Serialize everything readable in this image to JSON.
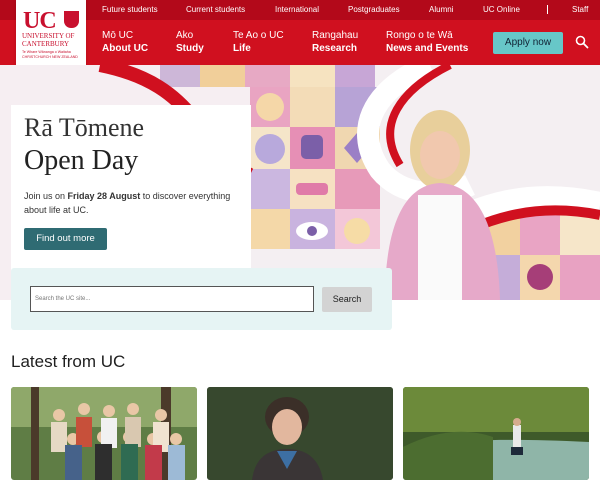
{
  "topbar": {
    "links": [
      "Future students",
      "Current students",
      "International",
      "Postgraduates",
      "Alumni",
      "UC Online",
      "Staff"
    ]
  },
  "logo": {
    "wordmark": "UC",
    "name_line1": "UNIVERSITY OF",
    "name_line2": "CANTERBURY",
    "maori_line1": "Te Whare Wānanga o Waitaha",
    "maori_line2": "CHRISTCHURCH NEW ZEALAND"
  },
  "nav": {
    "items": [
      {
        "maori": "Mō UC",
        "label": "About UC"
      },
      {
        "maori": "Ako",
        "label": "Study"
      },
      {
        "maori": "Te Ao o UC",
        "label": "Life"
      },
      {
        "maori": "Rangahau",
        "label": "Research"
      },
      {
        "maori": "Rongo o te Wā",
        "label": "News and Events"
      }
    ],
    "apply_label": "Apply now",
    "search_icon": "search-icon"
  },
  "hero": {
    "title_line1": "Rā Tōmene",
    "title_line2": "Open Day",
    "text_before": "Join us on ",
    "text_bold": "Friday 28 August",
    "text_after": " to discover everything about life at UC.",
    "cta_label": "Find out more"
  },
  "search": {
    "placeholder": "Search the UC site...",
    "button_label": "Search"
  },
  "latest": {
    "heading": "Latest from UC",
    "cards": [
      {
        "image": "group-photo-students"
      },
      {
        "image": "portrait-photo"
      },
      {
        "image": "river-forest-photo"
      }
    ]
  },
  "colors": {
    "topbar": "#b3091a",
    "nav": "#d0101f",
    "accent_button": "#67c7c8",
    "cta": "#2f6b73"
  }
}
